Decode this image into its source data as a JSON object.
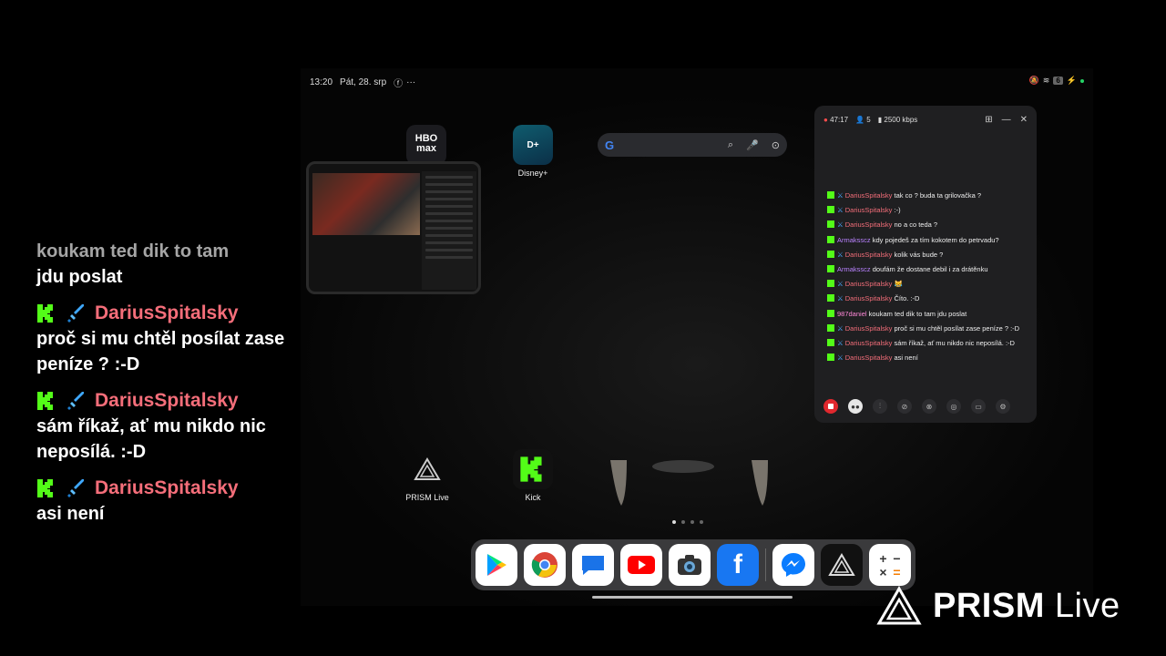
{
  "left_chat": [
    {
      "text": "koukam ted dik to tam",
      "faded": true
    },
    {
      "text": "jdu poslat"
    },
    {
      "username": "DariusSpitalsky",
      "text": "proč si mu chtěl posílat zase peníze ? :-D"
    },
    {
      "username": "DariusSpitalsky",
      "text": "sám říkaž, ať mu nikdo nic neposílá. :-D"
    },
    {
      "username": "DariusSpitalsky",
      "text": "asi není"
    }
  ],
  "status_bar": {
    "time": "13:20",
    "date": "Pát, 28. srp",
    "battery": "6"
  },
  "apps": {
    "hbo": "HBO max",
    "disney": "Disney+",
    "prism": "PRISM Live",
    "kick": "Kick"
  },
  "search": {
    "logo": "G"
  },
  "chat_window": {
    "timer": "47:17",
    "viewers": "5",
    "bitrate": "2500 kbps",
    "messages": [
      {
        "name": "DariusSpitalsky",
        "text": "tak co ? buda ta grilovačka ?",
        "badge": true,
        "nc": "n1"
      },
      {
        "name": "DariusSpitalsky",
        "text": ":-)",
        "badge": true,
        "nc": "n1"
      },
      {
        "name": "DariusSpitalsky",
        "text": "no a co teda ?",
        "badge": true,
        "nc": "n1"
      },
      {
        "name": "Armaksscz",
        "text": "kdy pojedeš za tím kokotem do petrvadu?",
        "badge": false,
        "nc": "n2"
      },
      {
        "name": "DariusSpitalsky",
        "text": "kolik vás bude ?",
        "badge": true,
        "nc": "n1"
      },
      {
        "name": "Armaksscz",
        "text": "doufám že dostane debil i za drátěnku",
        "badge": false,
        "nc": "n2"
      },
      {
        "name": "DariusSpitalsky",
        "text": "😹",
        "badge": true,
        "nc": "n1"
      },
      {
        "name": "DariusSpitalsky",
        "text": "Čítо. :-D",
        "badge": true,
        "nc": "n1"
      },
      {
        "name": "987daniel",
        "text": "koukam ted dik to tam jdu poslat",
        "badge": false,
        "nc": "n3"
      },
      {
        "name": "DariusSpitalsky",
        "text": "proč si mu chtěl posílat zase peníze ? :-D",
        "badge": true,
        "nc": "n1"
      },
      {
        "name": "DariusSpitalsky",
        "text": "sám říkaž, ať mu nikdo nic neposílá. :-D",
        "badge": true,
        "nc": "n1"
      },
      {
        "name": "DariusSpitalsky",
        "text": "asi není",
        "badge": true,
        "nc": "n1"
      }
    ]
  },
  "dock": [
    "Play Store",
    "Chrome",
    "Messages",
    "YouTube",
    "Camera",
    "Facebook",
    "Messenger",
    "PRISM Live",
    "Calculator"
  ],
  "watermark": {
    "brand": "PRISM",
    "suffix": "Live"
  },
  "colors": {
    "kick_green": "#53fc18",
    "username_red": "#f56e7a",
    "record_red": "#e0282e"
  }
}
